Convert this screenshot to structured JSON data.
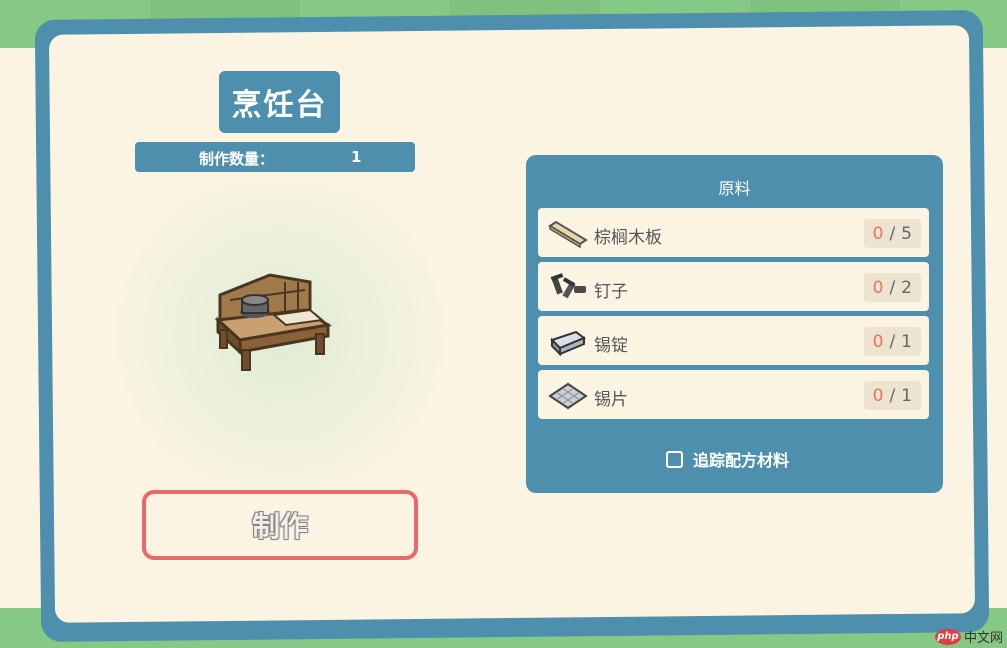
{
  "recipe": {
    "title": "烹饪台",
    "quantity_label": "制作数量：",
    "quantity_value": "1",
    "item_icon": "cooking-bench-icon",
    "craft_button": "制作"
  },
  "materials": {
    "title": "原料",
    "items": [
      {
        "name": "棕榈木板",
        "have": "0",
        "need": "5",
        "icon": "palm-plank-icon"
      },
      {
        "name": "钉子",
        "have": "0",
        "need": "2",
        "icon": "nails-icon"
      },
      {
        "name": "锡锭",
        "have": "0",
        "need": "1",
        "icon": "tin-ingot-icon"
      },
      {
        "name": "锡片",
        "have": "0",
        "need": "1",
        "icon": "tin-sheet-icon"
      }
    ],
    "track_label": "追踪配方材料",
    "track_checked": false
  },
  "watermark": {
    "logo": "php",
    "text": "中文网"
  },
  "colors": {
    "panel_blue": "#4d8fac",
    "cream": "#fbf4e2",
    "craft_border": "#e86a6a",
    "have_count": "#e8745e",
    "grass": "#86c985"
  }
}
